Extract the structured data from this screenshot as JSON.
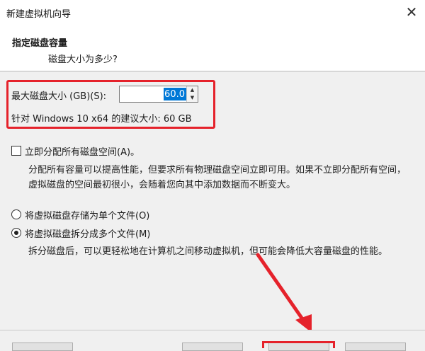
{
  "window": {
    "title": "新建虚拟机向导",
    "close_glyph": "✕"
  },
  "header": {
    "title": "指定磁盘容量",
    "subtitle": "磁盘大小为多少?"
  },
  "disk_size": {
    "label": "最大磁盘大小 (GB)(S):",
    "value": "60.0",
    "spin_up_glyph": "▲",
    "spin_down_glyph": "▼",
    "recommendation": "针对 Windows 10 x64 的建议大小: 60 GB"
  },
  "allocate": {
    "label": "立即分配所有磁盘空间(A)。",
    "checked": false,
    "description": "分配所有容量可以提高性能，但要求所有物理磁盘空间立即可用。如果不立即分配所有空间，虚拟磁盘的空间最初很小，会随着您向其中添加数据而不断变大。"
  },
  "storage_options": [
    {
      "label": "将虚拟磁盘存储为单个文件(O)",
      "selected": false
    },
    {
      "label": "将虚拟磁盘拆分成多个文件(M)",
      "selected": true
    }
  ],
  "split_description": "拆分磁盘后，可以更轻松地在计算机之间移动虚拟机，但可能会降低大容量磁盘的性能。",
  "colors": {
    "annotation_red": "#e5222b",
    "selection_blue": "#0078d7"
  }
}
